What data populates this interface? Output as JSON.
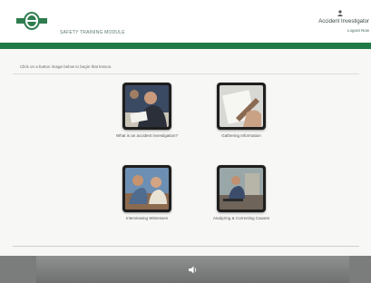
{
  "header": {
    "brand_text": "SAFETY TRAINING MODULE",
    "role_name": "Accident Investigator",
    "logout_label": "Logout Now",
    "logo_icon": "shield-logo-icon",
    "user_icon": "user-icon"
  },
  "main": {
    "instruction": "Click on a button image below to begin that lesson.",
    "tiles": [
      {
        "label": "What is an accident investigation?",
        "icon": "meeting-photo-icon"
      },
      {
        "label": "Gathering Information",
        "icon": "writing-photo-icon"
      },
      {
        "label": "Interviewing Witnesses",
        "icon": "interview-photo-icon"
      },
      {
        "label": "Analyzing & Correcting Causes",
        "icon": "worksite-photo-icon"
      }
    ]
  },
  "footer": {
    "speaker_icon": "speaker-icon"
  },
  "colors": {
    "accent_green": "#1f7a47",
    "footer_gray": "#7a7d7b"
  }
}
